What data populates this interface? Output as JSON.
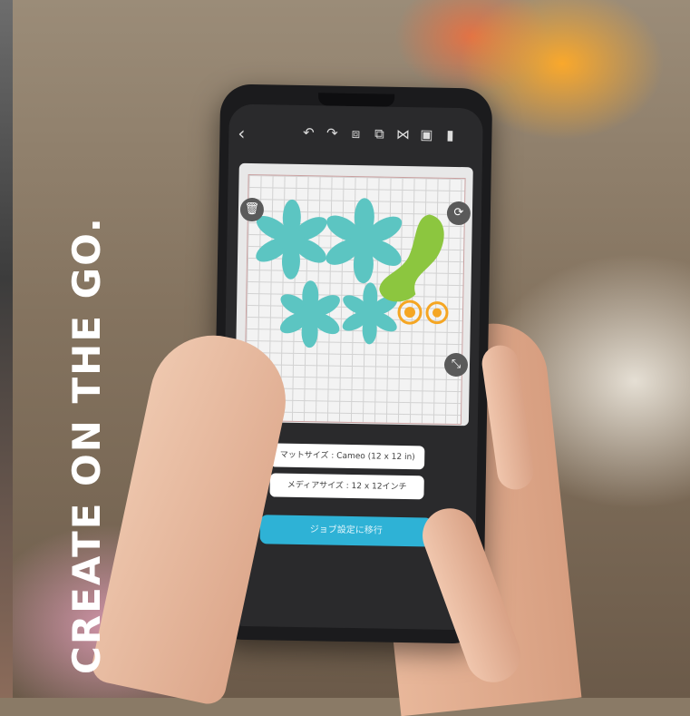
{
  "tagline": "CREATE ON THE GO.",
  "app": {
    "toolbar": {
      "back_icon": "chevron-left-icon",
      "tools": [
        "undo-icon",
        "redo-icon",
        "group-icon",
        "ungroup-icon",
        "flip-icon",
        "replicate-icon",
        "save-icon"
      ]
    },
    "mat_size_label": "マットサイズ : Cameo (12 x 12 in)",
    "media_size_label": "メディアサイズ : 12 x 12インチ",
    "proceed_button_label": "ジョブ設定に移行"
  },
  "colors": {
    "shape_teal": "#5cc5c2",
    "shape_green": "#8cc63f",
    "shape_orange": "#f5a623",
    "accent_button": "#2eb2d6"
  }
}
